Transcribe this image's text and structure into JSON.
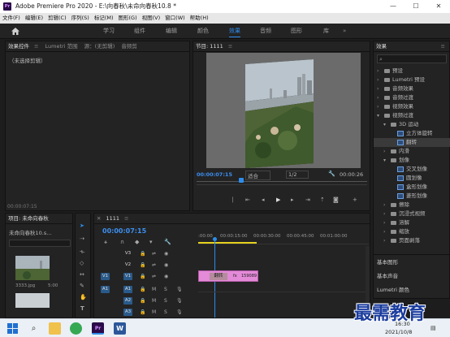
{
  "window": {
    "title": "Adobe Premiere Pro 2020 - E:\\向春秋\\未命向春秋10.8 *",
    "app_icon": "Pr"
  },
  "menu": [
    "文件(F)",
    "编辑(E)",
    "剪辑(C)",
    "序列(S)",
    "标记(M)",
    "图形(G)",
    "视图(V)",
    "窗口(W)",
    "帮助(H)"
  ],
  "workspaces": [
    "学习",
    "组件",
    "编辑",
    "颜色",
    "效果",
    "音频",
    "图形",
    "库"
  ],
  "active_workspace": "效果",
  "source_panel": {
    "tabs": [
      "效果控件",
      "Lumetri 范围",
      "源：(无剪辑)",
      "音频剪"
    ],
    "message": "（未选择剪辑）",
    "timecode": "00:00:07:15"
  },
  "program_monitor": {
    "tab": "节目: 1111",
    "timecode_left": "00:00:07:15",
    "fit": "适合",
    "quality": "1/2",
    "timecode_right": "00:00:26"
  },
  "effects_panel": {
    "tab": "效果",
    "search": "",
    "tree": [
      {
        "label": "预设",
        "type": "folder",
        "depth": 0
      },
      {
        "label": "Lumetri 预设",
        "type": "folder",
        "depth": 0
      },
      {
        "label": "音频效果",
        "type": "folder",
        "depth": 0
      },
      {
        "label": "音频过渡",
        "type": "folder",
        "depth": 0
      },
      {
        "label": "视频效果",
        "type": "folder",
        "depth": 0
      },
      {
        "label": "视频过渡",
        "type": "folder",
        "depth": 0,
        "open": true
      },
      {
        "label": "3D 运动",
        "type": "folder",
        "depth": 1,
        "open": true
      },
      {
        "label": "立方体旋转",
        "type": "fx",
        "depth": 2
      },
      {
        "label": "翻转",
        "type": "fx",
        "depth": 2,
        "selected": true
      },
      {
        "label": "内滑",
        "type": "folder",
        "depth": 1
      },
      {
        "label": "划像",
        "type": "folder",
        "depth": 1,
        "open": true
      },
      {
        "label": "交叉划像",
        "type": "fx",
        "depth": 2
      },
      {
        "label": "圆划像",
        "type": "fx",
        "depth": 2
      },
      {
        "label": "盒形划像",
        "type": "fx",
        "depth": 2
      },
      {
        "label": "菱形划像",
        "type": "fx",
        "depth": 2
      },
      {
        "label": "擦除",
        "type": "folder",
        "depth": 1
      },
      {
        "label": "沉浸式视频",
        "type": "folder",
        "depth": 1
      },
      {
        "label": "溶解",
        "type": "folder",
        "depth": 1
      },
      {
        "label": "缩放",
        "type": "folder",
        "depth": 1
      },
      {
        "label": "页面剥落",
        "type": "folder",
        "depth": 1
      }
    ],
    "sections": [
      "基本图形",
      "基本声音",
      "Lumetri 颜色"
    ]
  },
  "project_panel": {
    "tab": "项目: 未命向春秋",
    "file": "未命向春秋10.s...",
    "clip_name": "3333.jpg",
    "clip_duration": "5:00"
  },
  "timeline": {
    "tab": "1111",
    "timecode": "00:00:07:15",
    "ruler": [
      ":00:00",
      "00:00:15:00",
      "00:00:30:00",
      "00:00:45:00",
      "00:01:00:00"
    ],
    "video_tracks": [
      "V3",
      "V2",
      "V1"
    ],
    "audio_tracks": [
      "A1",
      "A2",
      "A3"
    ],
    "clip_label": "翻转",
    "clip_name": "159089"
  },
  "taskbar": {
    "time": "16:30",
    "date": "2021/10/8"
  },
  "watermark": "最需教育"
}
